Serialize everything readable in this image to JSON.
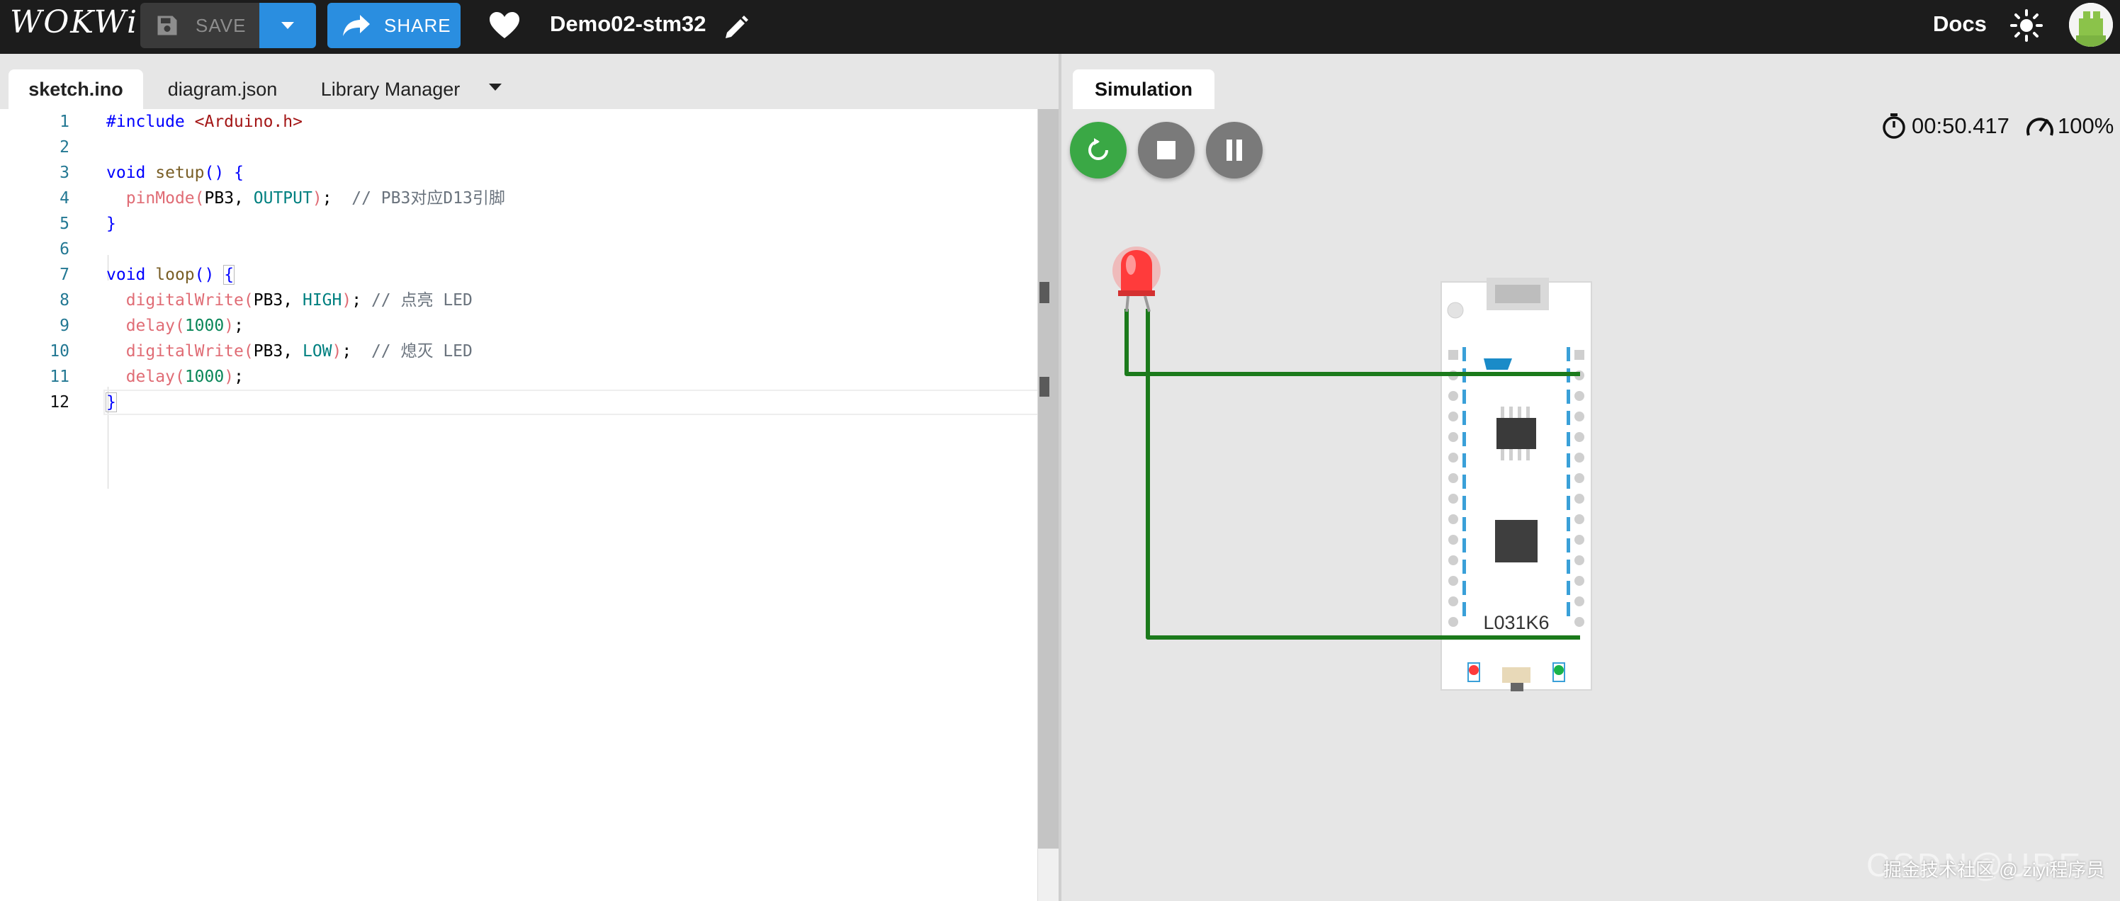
{
  "app": {
    "logo": "WOKWi",
    "project_title": "Demo02-stm32",
    "docs_label": "Docs"
  },
  "toolbar": {
    "save_label": "SAVE",
    "share_label": "SHARE"
  },
  "editor": {
    "tabs": [
      "sketch.ino",
      "diagram.json",
      "Library Manager"
    ],
    "active_tab": "sketch.ino",
    "line_numbers": [
      "1",
      "2",
      "3",
      "4",
      "5",
      "6",
      "7",
      "8",
      "9",
      "10",
      "11",
      "12"
    ],
    "current_line": 12,
    "code_lines": [
      "#include <Arduino.h>",
      "",
      "void setup() {",
      "  pinMode(PB3, OUTPUT);  // PB3对应D13引脚",
      "}",
      "",
      "void loop() {",
      "  digitalWrite(PB3, HIGH); // 点亮 LED",
      "  delay(1000);",
      "  digitalWrite(PB3, LOW);  // 熄灭 LED",
      "  delay(1000);",
      "}"
    ]
  },
  "simulation": {
    "tab_label": "Simulation",
    "timer": "00:50.417",
    "speed": "100%",
    "board_label": "L031K6",
    "led_state": "on",
    "led_color": "#ff3b3b",
    "wire_color": "#1b7a1b"
  },
  "watermark": {
    "text": "掘金技术社区 @ ziyi程序员",
    "faint_text": "CSDN@URE"
  },
  "colors": {
    "accent": "#2a8ee0",
    "topbar": "#1c1c1c",
    "play_green": "#3aa845",
    "control_gray": "#7a7a7a"
  }
}
